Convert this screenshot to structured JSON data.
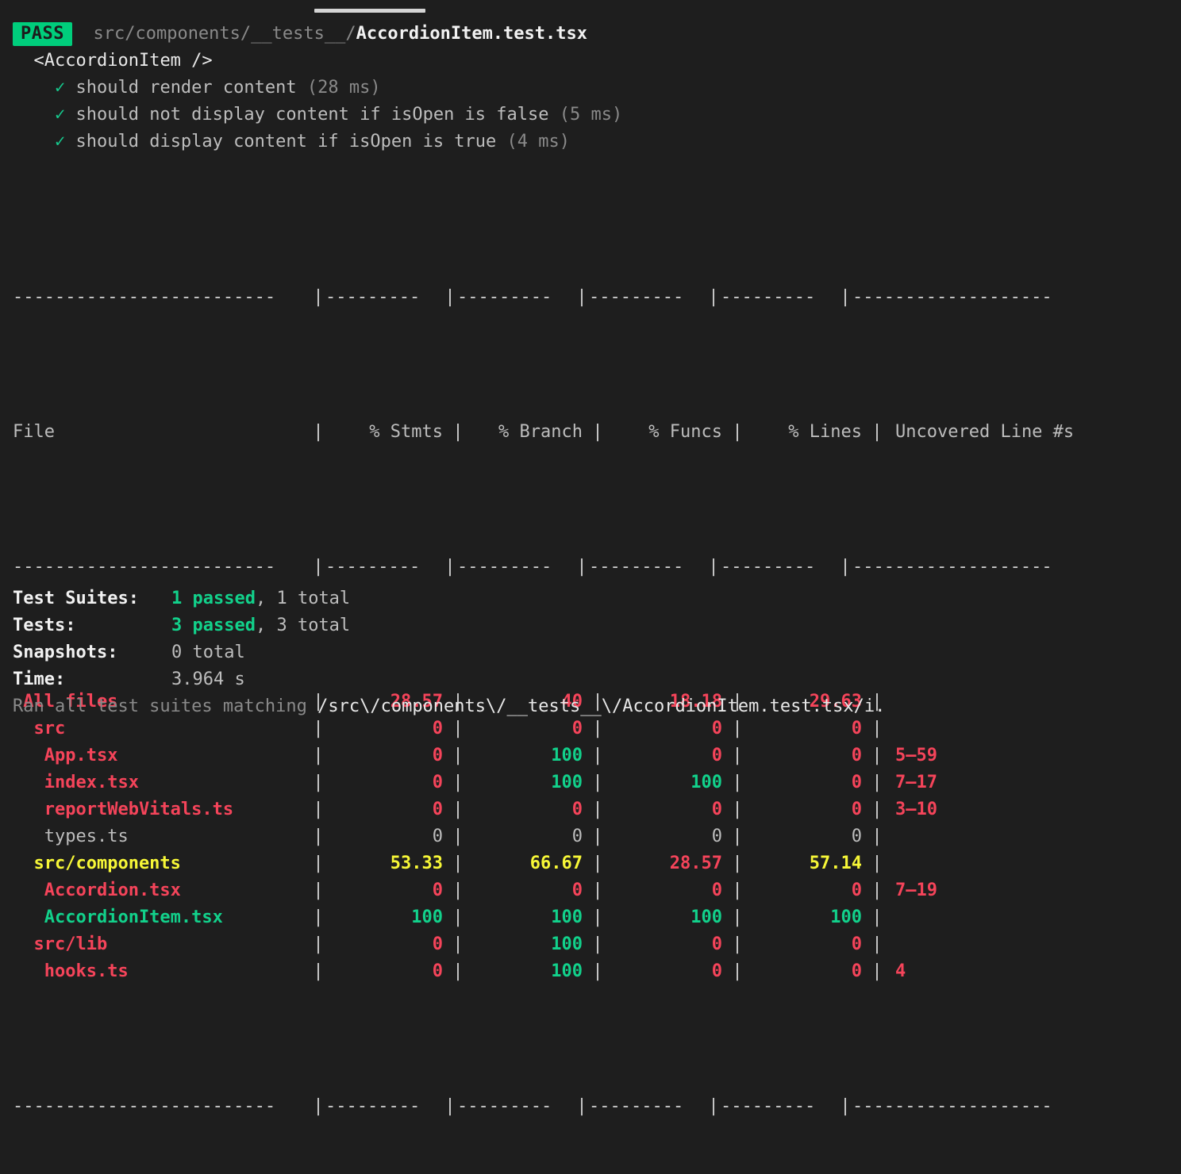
{
  "terminal": {
    "background": "#1e1e1e",
    "progress_bar_visible": true
  },
  "header": {
    "status_badge": "PASS",
    "badge_bg": "#00ce7c",
    "path_prefix": "src/components/__tests__/",
    "file_name": "AccordionItem.test.tsx",
    "suite_name": "<AccordionItem />"
  },
  "tests": [
    {
      "mark": "✓",
      "name": "should render content",
      "duration": "(28 ms)"
    },
    {
      "mark": "✓",
      "name": "should not display content if isOpen is false",
      "duration": "(5 ms)"
    },
    {
      "mark": "✓",
      "name": "should display content if isOpen is true",
      "duration": "(4 ms)"
    }
  ],
  "coverage_table": {
    "headers": [
      "File",
      "% Stmts",
      "% Branch",
      "% Funcs",
      "% Lines",
      "Uncovered Line #s"
    ],
    "rules": {
      "file": "-------------------------",
      "num": "---------",
      "last": "-------------------"
    },
    "rows": [
      {
        "file": "All files",
        "indent": 0,
        "color": "red",
        "stmts": "28.57",
        "stmts_color": "red",
        "branch": "40",
        "branch_color": "red",
        "funcs": "18.18",
        "funcs_color": "red",
        "lines": "29.63",
        "lines_color": "red",
        "uncovered": "",
        "uncovered_color": "red"
      },
      {
        "file": "src",
        "indent": 1,
        "color": "red",
        "stmts": "0",
        "stmts_color": "red",
        "branch": "0",
        "branch_color": "red",
        "funcs": "0",
        "funcs_color": "red",
        "lines": "0",
        "lines_color": "red",
        "uncovered": "",
        "uncovered_color": "red"
      },
      {
        "file": "App.tsx",
        "indent": 2,
        "color": "red",
        "stmts": "0",
        "stmts_color": "red",
        "branch": "100",
        "branch_color": "green",
        "funcs": "0",
        "funcs_color": "red",
        "lines": "0",
        "lines_color": "red",
        "uncovered": "5–59",
        "uncovered_color": "red"
      },
      {
        "file": "index.tsx",
        "indent": 2,
        "color": "red",
        "stmts": "0",
        "stmts_color": "red",
        "branch": "100",
        "branch_color": "green",
        "funcs": "100",
        "funcs_color": "green",
        "lines": "0",
        "lines_color": "red",
        "uncovered": "7–17",
        "uncovered_color": "red"
      },
      {
        "file": "reportWebVitals.ts",
        "indent": 2,
        "color": "red",
        "stmts": "0",
        "stmts_color": "red",
        "branch": "0",
        "branch_color": "red",
        "funcs": "0",
        "funcs_color": "red",
        "lines": "0",
        "lines_color": "red",
        "uncovered": "3–10",
        "uncovered_color": "red"
      },
      {
        "file": "types.ts",
        "indent": 2,
        "color": "grey",
        "stmts": "0",
        "stmts_color": "grey",
        "branch": "0",
        "branch_color": "grey",
        "funcs": "0",
        "funcs_color": "grey",
        "lines": "0",
        "lines_color": "grey",
        "uncovered": "",
        "uncovered_color": "grey"
      },
      {
        "file": "src/components",
        "indent": 1,
        "color": "yellow",
        "stmts": "53.33",
        "stmts_color": "yellow",
        "branch": "66.67",
        "branch_color": "yellow",
        "funcs": "28.57",
        "funcs_color": "red",
        "lines": "57.14",
        "lines_color": "yellow",
        "uncovered": "",
        "uncovered_color": "red"
      },
      {
        "file": "Accordion.tsx",
        "indent": 2,
        "color": "red",
        "stmts": "0",
        "stmts_color": "red",
        "branch": "0",
        "branch_color": "red",
        "funcs": "0",
        "funcs_color": "red",
        "lines": "0",
        "lines_color": "red",
        "uncovered": "7–19",
        "uncovered_color": "red"
      },
      {
        "file": "AccordionItem.tsx",
        "indent": 2,
        "color": "green",
        "stmts": "100",
        "stmts_color": "green",
        "branch": "100",
        "branch_color": "green",
        "funcs": "100",
        "funcs_color": "green",
        "lines": "100",
        "lines_color": "green",
        "uncovered": "",
        "uncovered_color": "green"
      },
      {
        "file": "src/lib",
        "indent": 1,
        "color": "red",
        "stmts": "0",
        "stmts_color": "red",
        "branch": "100",
        "branch_color": "green",
        "funcs": "0",
        "funcs_color": "red",
        "lines": "0",
        "lines_color": "red",
        "uncovered": "",
        "uncovered_color": "red"
      },
      {
        "file": "hooks.ts",
        "indent": 2,
        "color": "red",
        "stmts": "0",
        "stmts_color": "red",
        "branch": "100",
        "branch_color": "green",
        "funcs": "0",
        "funcs_color": "red",
        "lines": "0",
        "lines_color": "red",
        "uncovered": "4",
        "uncovered_color": "red"
      }
    ]
  },
  "summary": {
    "test_suites_label": "Test Suites:",
    "test_suites_passed": "1 passed",
    "test_suites_total": ", 1 total",
    "tests_label": "Tests:",
    "tests_passed": "3 passed",
    "tests_total": ", 3 total",
    "snapshots_label": "Snapshots:",
    "snapshots_value": "0 total",
    "time_label": "Time:",
    "time_value": "3.964 s",
    "ran_prefix": "Ran all test suites matching ",
    "ran_pattern": "/src\\/components\\/__tests__\\/AccordionItem.test.tsx/i."
  }
}
